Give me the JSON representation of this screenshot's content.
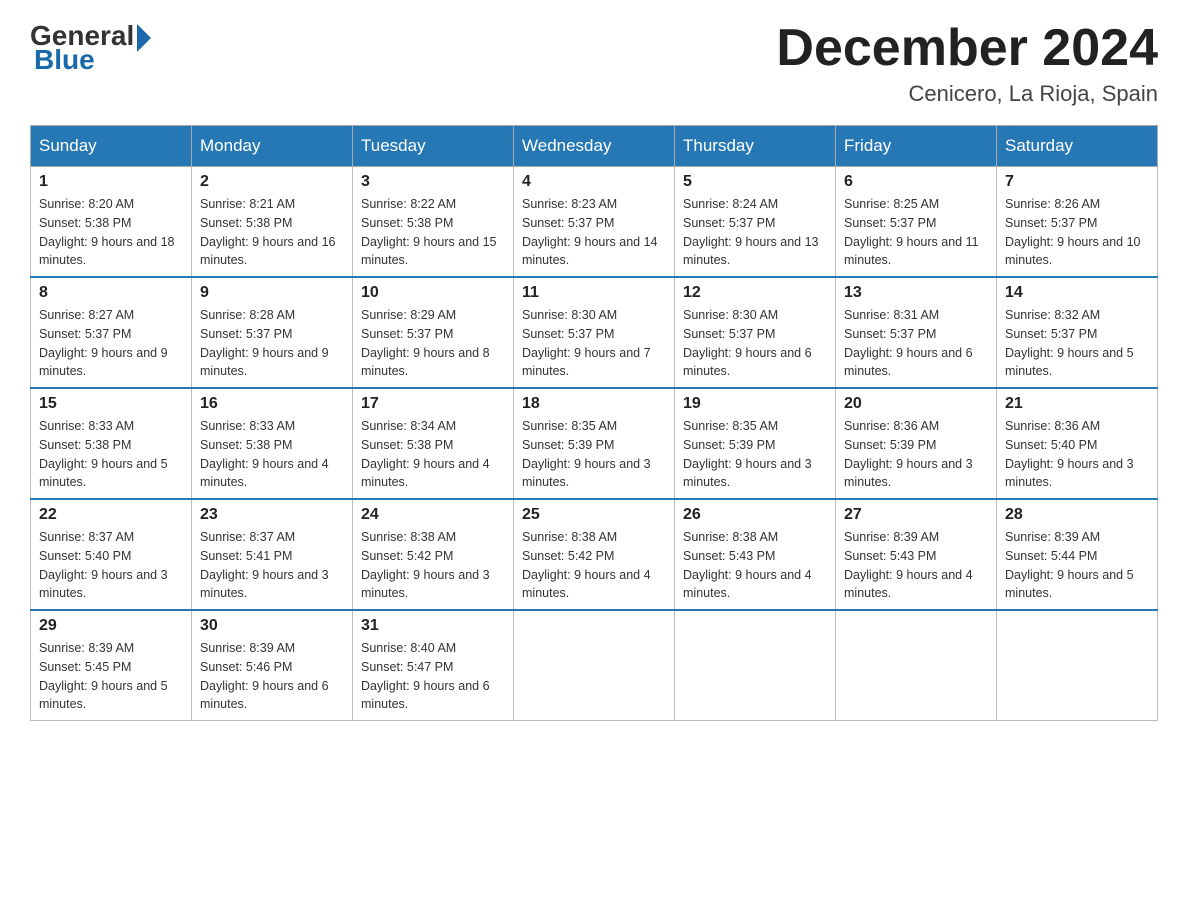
{
  "header": {
    "logo_general": "General",
    "logo_blue": "Blue",
    "month_title": "December 2024",
    "location": "Cenicero, La Rioja, Spain"
  },
  "days_of_week": [
    "Sunday",
    "Monday",
    "Tuesday",
    "Wednesday",
    "Thursday",
    "Friday",
    "Saturday"
  ],
  "weeks": [
    [
      {
        "day": "1",
        "sunrise": "8:20 AM",
        "sunset": "5:38 PM",
        "daylight": "9 hours and 18 minutes."
      },
      {
        "day": "2",
        "sunrise": "8:21 AM",
        "sunset": "5:38 PM",
        "daylight": "9 hours and 16 minutes."
      },
      {
        "day": "3",
        "sunrise": "8:22 AM",
        "sunset": "5:38 PM",
        "daylight": "9 hours and 15 minutes."
      },
      {
        "day": "4",
        "sunrise": "8:23 AM",
        "sunset": "5:37 PM",
        "daylight": "9 hours and 14 minutes."
      },
      {
        "day": "5",
        "sunrise": "8:24 AM",
        "sunset": "5:37 PM",
        "daylight": "9 hours and 13 minutes."
      },
      {
        "day": "6",
        "sunrise": "8:25 AM",
        "sunset": "5:37 PM",
        "daylight": "9 hours and 11 minutes."
      },
      {
        "day": "7",
        "sunrise": "8:26 AM",
        "sunset": "5:37 PM",
        "daylight": "9 hours and 10 minutes."
      }
    ],
    [
      {
        "day": "8",
        "sunrise": "8:27 AM",
        "sunset": "5:37 PM",
        "daylight": "9 hours and 9 minutes."
      },
      {
        "day": "9",
        "sunrise": "8:28 AM",
        "sunset": "5:37 PM",
        "daylight": "9 hours and 9 minutes."
      },
      {
        "day": "10",
        "sunrise": "8:29 AM",
        "sunset": "5:37 PM",
        "daylight": "9 hours and 8 minutes."
      },
      {
        "day": "11",
        "sunrise": "8:30 AM",
        "sunset": "5:37 PM",
        "daylight": "9 hours and 7 minutes."
      },
      {
        "day": "12",
        "sunrise": "8:30 AM",
        "sunset": "5:37 PM",
        "daylight": "9 hours and 6 minutes."
      },
      {
        "day": "13",
        "sunrise": "8:31 AM",
        "sunset": "5:37 PM",
        "daylight": "9 hours and 6 minutes."
      },
      {
        "day": "14",
        "sunrise": "8:32 AM",
        "sunset": "5:37 PM",
        "daylight": "9 hours and 5 minutes."
      }
    ],
    [
      {
        "day": "15",
        "sunrise": "8:33 AM",
        "sunset": "5:38 PM",
        "daylight": "9 hours and 5 minutes."
      },
      {
        "day": "16",
        "sunrise": "8:33 AM",
        "sunset": "5:38 PM",
        "daylight": "9 hours and 4 minutes."
      },
      {
        "day": "17",
        "sunrise": "8:34 AM",
        "sunset": "5:38 PM",
        "daylight": "9 hours and 4 minutes."
      },
      {
        "day": "18",
        "sunrise": "8:35 AM",
        "sunset": "5:39 PM",
        "daylight": "9 hours and 3 minutes."
      },
      {
        "day": "19",
        "sunrise": "8:35 AM",
        "sunset": "5:39 PM",
        "daylight": "9 hours and 3 minutes."
      },
      {
        "day": "20",
        "sunrise": "8:36 AM",
        "sunset": "5:39 PM",
        "daylight": "9 hours and 3 minutes."
      },
      {
        "day": "21",
        "sunrise": "8:36 AM",
        "sunset": "5:40 PM",
        "daylight": "9 hours and 3 minutes."
      }
    ],
    [
      {
        "day": "22",
        "sunrise": "8:37 AM",
        "sunset": "5:40 PM",
        "daylight": "9 hours and 3 minutes."
      },
      {
        "day": "23",
        "sunrise": "8:37 AM",
        "sunset": "5:41 PM",
        "daylight": "9 hours and 3 minutes."
      },
      {
        "day": "24",
        "sunrise": "8:38 AM",
        "sunset": "5:42 PM",
        "daylight": "9 hours and 3 minutes."
      },
      {
        "day": "25",
        "sunrise": "8:38 AM",
        "sunset": "5:42 PM",
        "daylight": "9 hours and 4 minutes."
      },
      {
        "day": "26",
        "sunrise": "8:38 AM",
        "sunset": "5:43 PM",
        "daylight": "9 hours and 4 minutes."
      },
      {
        "day": "27",
        "sunrise": "8:39 AM",
        "sunset": "5:43 PM",
        "daylight": "9 hours and 4 minutes."
      },
      {
        "day": "28",
        "sunrise": "8:39 AM",
        "sunset": "5:44 PM",
        "daylight": "9 hours and 5 minutes."
      }
    ],
    [
      {
        "day": "29",
        "sunrise": "8:39 AM",
        "sunset": "5:45 PM",
        "daylight": "9 hours and 5 minutes."
      },
      {
        "day": "30",
        "sunrise": "8:39 AM",
        "sunset": "5:46 PM",
        "daylight": "9 hours and 6 minutes."
      },
      {
        "day": "31",
        "sunrise": "8:40 AM",
        "sunset": "5:47 PM",
        "daylight": "9 hours and 6 minutes."
      },
      null,
      null,
      null,
      null
    ]
  ]
}
